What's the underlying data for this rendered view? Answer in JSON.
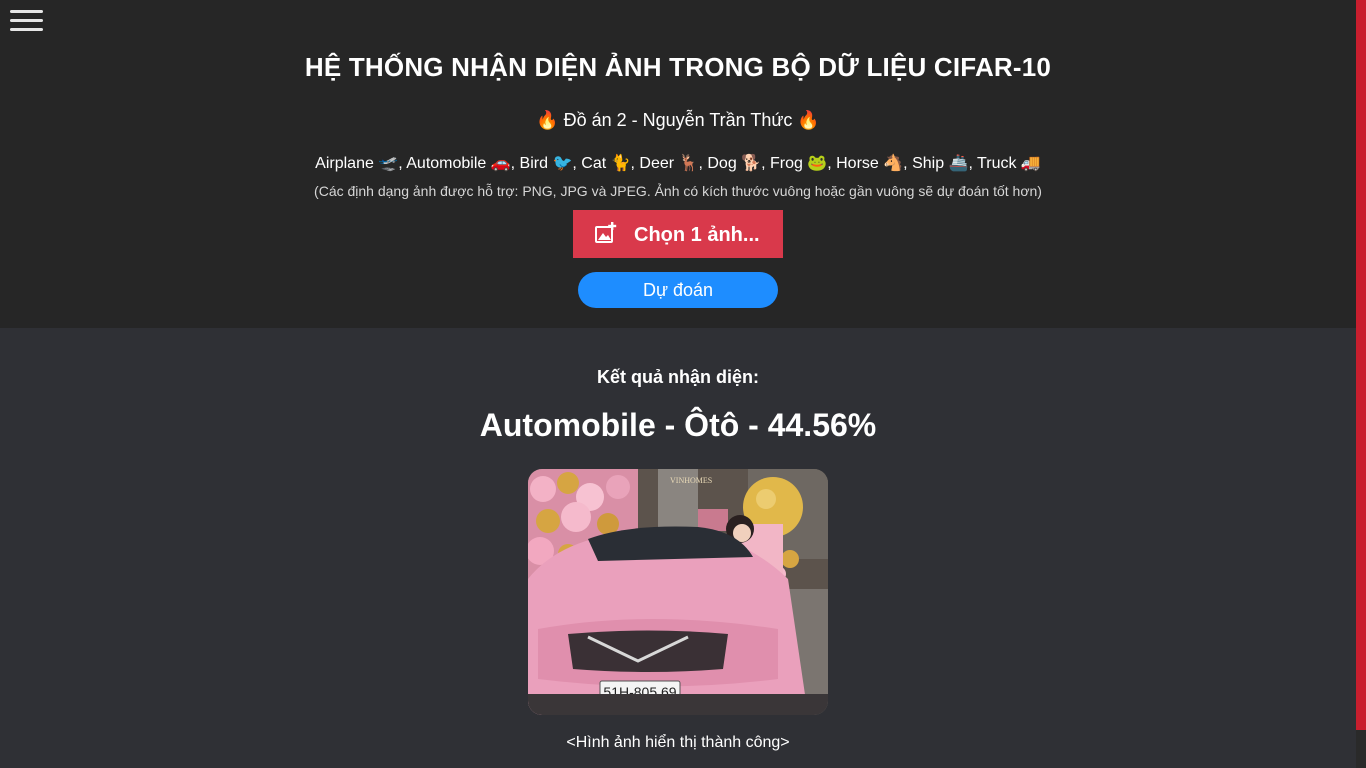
{
  "menu": {
    "icon": "hamburger-menu-icon"
  },
  "header": {
    "title": "HỆ THỐNG NHẬN DIỆN ẢNH TRONG BỘ DỮ LIỆU CIFAR-10",
    "subtitle": "🔥 Đồ án 2 - Nguyễn Trần Thức 🔥",
    "classes": "Airplane 🛫, Automobile 🚗, Bird 🐦, Cat 🐈, Deer 🦌, Dog 🐕, Frog 🐸, Horse 🐴, Ship 🚢, Truck 🚚",
    "note": "(Các định dạng ảnh được hỗ trợ: PNG, JPG và JPEG. Ảnh có kích thước vuông hoặc gần vuông sẽ dự đoán tốt hơn)",
    "choose_button": {
      "label": "Chọn 1 ảnh...",
      "icon": "add-image-icon"
    },
    "predict_button": {
      "label": "Dự đoán"
    }
  },
  "result": {
    "heading": "Kết quả nhận diện:",
    "value": "Automobile - Ôtô - 44.56%",
    "license_plate": "51H-805.69",
    "building_sign": "VINHOMES",
    "caption": "<Hình ảnh hiển thị thành công>"
  },
  "colors": {
    "header_bg": "#262626",
    "body_bg": "#2f3035",
    "choose_button": "#d9394b",
    "predict_button": "#1e8dff",
    "scrollbar_thumb": "#c81e2e",
    "car_pink": "#eaa0bc"
  }
}
